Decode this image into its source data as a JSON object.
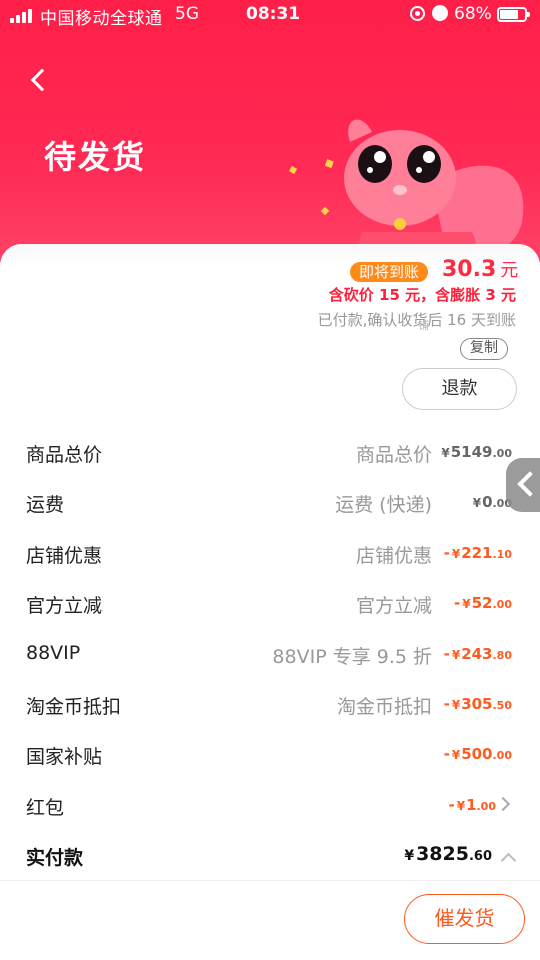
{
  "status_bar": {
    "carrier": "中国移动全球通",
    "network": "5G",
    "time": "08:31",
    "battery": "68%"
  },
  "header": {
    "title": "待发货"
  },
  "order": {
    "to_arrive_badge": "即将到账",
    "amount": "30.3",
    "amount_unit": "元",
    "cut_info": "含砍价 15 元，含膨胀 3 元",
    "paid_note": "已付款,确认收货后 16 天到账",
    "shop_fragment": "铺",
    "copy_label": "复制",
    "refund_label": "退款"
  },
  "price_rows": [
    {
      "label": "商品总价",
      "desc": "商品总价",
      "yen": "¥",
      "int": "5149",
      "dec": ".00",
      "neg": ""
    },
    {
      "label": "运费",
      "desc": "运费 (快递)",
      "yen": "¥",
      "int": "0",
      "dec": ".00",
      "neg": ""
    },
    {
      "label": "店铺优惠",
      "desc": "店铺优惠",
      "yen": "¥",
      "int": "221",
      "dec": ".10",
      "neg": "-"
    },
    {
      "label": "官方立减",
      "desc": "官方立减",
      "yen": "¥",
      "int": "52",
      "dec": ".00",
      "neg": "-"
    },
    {
      "label": "88VIP",
      "desc": "88VIP 专享 9.5 折",
      "yen": "¥",
      "int": "243",
      "dec": ".80",
      "neg": "-"
    },
    {
      "label": "淘金币抵扣",
      "desc": "淘金币抵扣",
      "yen": "¥",
      "int": "305",
      "dec": ".50",
      "neg": "-"
    },
    {
      "label": "国家补贴",
      "desc": "",
      "yen": "¥",
      "int": "500",
      "dec": ".00",
      "neg": "-"
    },
    {
      "label": "红包",
      "desc": "",
      "yen": "¥",
      "int": "1",
      "dec": ".00",
      "neg": "-"
    }
  ],
  "total": {
    "label": "实付款",
    "yen": "¥",
    "int": "3825",
    "dec": ".60"
  },
  "bottom": {
    "urge_label": "催发货"
  },
  "colors": {
    "brand_red": "#ff1f48",
    "discount_orange": "#ff5a1f",
    "badge_orange": "#ff8a1a"
  },
  "icons": [
    "back-arrow-icon",
    "chevron-right-icon",
    "chevron-up-icon",
    "side-handle-icon",
    "signal-icon",
    "battery-icon",
    "alarm-icon",
    "rotation-lock-icon"
  ]
}
